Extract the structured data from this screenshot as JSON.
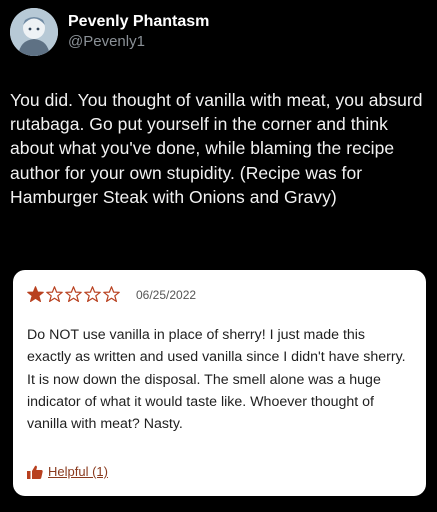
{
  "tweet": {
    "author": {
      "display_name": "Pevenly Phantasm",
      "handle": "@Pevenly1",
      "avatar_icon": "avatar-image"
    },
    "text": "You did. You thought of vanilla with meat, you absurd rutabaga. Go put yourself in the corner and think about what you've done, while blaming the recipe author for your own stupidity. (Recipe was for Hamburger Steak with Onions and Gravy)"
  },
  "review": {
    "rating": 1,
    "rating_max": 5,
    "star_color": "#b8401f",
    "date": "06/25/2022",
    "body": "Do NOT use vanilla in place of sherry! I just made this exactly as written and used vanilla since I didn't have sherry. It is now down the disposal. The smell alone was a huge indicator of what it would taste like. Whoever thought of vanilla with meat? Nasty.",
    "helpful_label": "Helpful (1)",
    "helpful_icon": "thumbs-up-icon"
  }
}
